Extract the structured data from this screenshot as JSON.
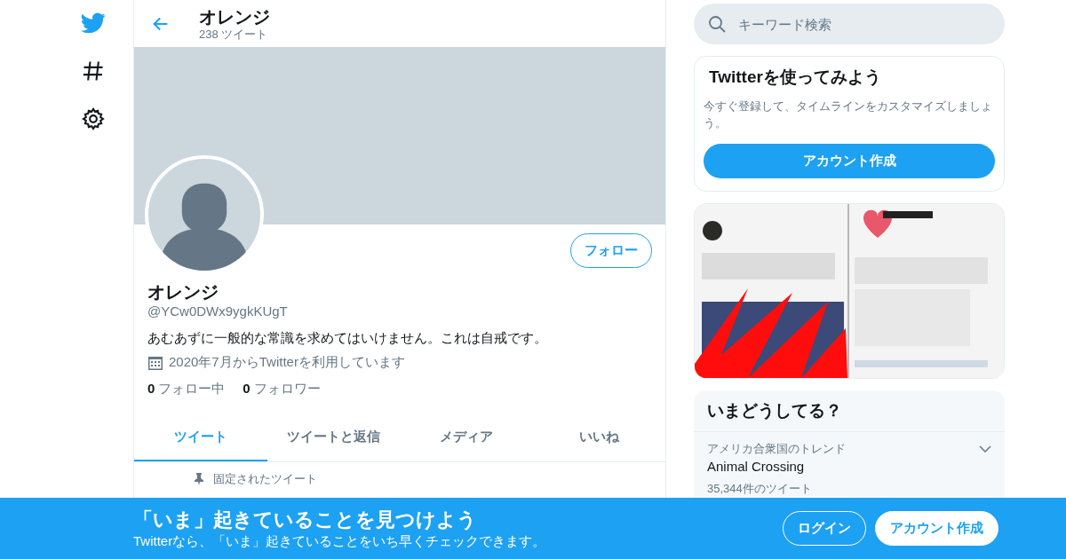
{
  "header": {
    "title": "オレンジ",
    "tweet_count": "238 ツイート"
  },
  "profile": {
    "name": "オレンジ",
    "handle": "@YCw0DWx9ygkKUgT",
    "bio": "あむあずに一般的な常識を求めてはいけません。これは自戒です。",
    "joined": "2020年7月からTwitterを利用しています",
    "following_count": "0",
    "following_label": "フォロー中",
    "followers_count": "0",
    "followers_label": "フォロワー",
    "follow_button": "フォロー"
  },
  "tabs": [
    {
      "label": "ツイート",
      "selected": true
    },
    {
      "label": "ツイートと返信",
      "selected": false
    },
    {
      "label": "メディア",
      "selected": false
    },
    {
      "label": "いいね",
      "selected": false
    }
  ],
  "pinned_tweet": {
    "label": "固定されたツイート"
  },
  "search": {
    "placeholder": "キーワード検索"
  },
  "signup_card": {
    "title": "Twitterを使ってみよう",
    "text": "今すぐ登録して、タイムラインをカスタマイズしましょう。",
    "button": "アカウント作成"
  },
  "trends": {
    "title": "いまどうしてる？",
    "items": [
      {
        "context": "アメリカ合衆国のトレンド",
        "name": "Animal Crossing",
        "count": "35,344件のツイート"
      }
    ]
  },
  "bottom_bar": {
    "title": "「いま」起きていることを見つけよう",
    "text": "Twitterなら、「いま」起きていることをいち早くチェックできます。",
    "buttons": [
      {
        "label": "ログイン",
        "kind": "outline"
      },
      {
        "label": "アカウント作成",
        "kind": "filled"
      }
    ]
  }
}
